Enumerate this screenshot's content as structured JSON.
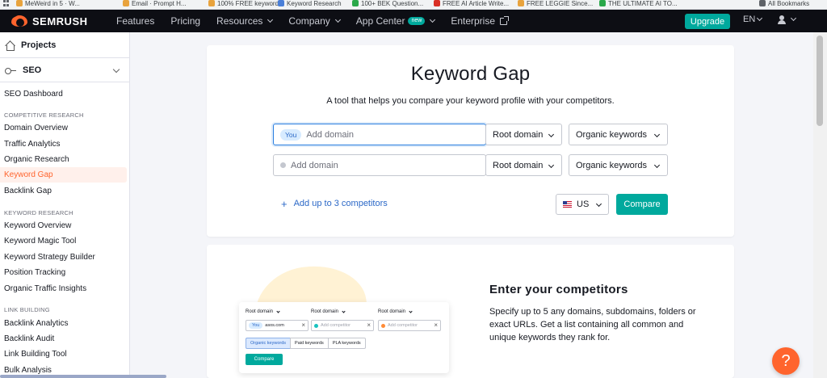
{
  "bookmarks": {
    "items": [
      {
        "label": "MeWeird in 5 · W...",
        "color": "#e8a33d"
      },
      {
        "label": "Email · Prompt H...",
        "color": "#e8a33d"
      },
      {
        "label": "100% FREE keyword...",
        "color": "#e8a33d"
      },
      {
        "label": "Keyword Research",
        "color": "#4a7fd8"
      },
      {
        "label": "100+ BEK Question...",
        "color": "#2aa84a"
      },
      {
        "label": "FREE AI Article Write...",
        "color": "#d93025"
      },
      {
        "label": "FREE LEGGIE Since...",
        "color": "#e8a33d"
      },
      {
        "label": "THE ULTIMATE AI TO...",
        "color": "#2aa84a"
      }
    ],
    "all_bookmarks": "All Bookmarks"
  },
  "nav": {
    "logo": "SEMRUSH",
    "items": [
      "Features",
      "Pricing",
      "Resources",
      "Company",
      "App Center",
      "Enterprise"
    ],
    "new_badge": "new",
    "upgrade": "Upgrade",
    "lang": "EN"
  },
  "sidebar": {
    "projects": "Projects",
    "seo": "SEO",
    "dashboard": "SEO Dashboard",
    "sections": {
      "competitive": "COMPETITIVE RESEARCH",
      "keyword": "KEYWORD RESEARCH",
      "link": "LINK BUILDING"
    },
    "competitive_items": [
      "Domain Overview",
      "Traffic Analytics",
      "Organic Research",
      "Keyword Gap",
      "Backlink Gap"
    ],
    "keyword_items": [
      "Keyword Overview",
      "Keyword Magic Tool",
      "Keyword Strategy Builder",
      "Position Tracking",
      "Organic Traffic Insights"
    ],
    "link_items": [
      "Backlink Analytics",
      "Backlink Audit",
      "Link Building Tool",
      "Bulk Analysis"
    ],
    "active_item": "Keyword Gap"
  },
  "main": {
    "title": "Keyword Gap",
    "subtitle": "A tool that helps you compare your keyword profile with your competitors.",
    "row1": {
      "chip": "You",
      "placeholder": "Add domain",
      "scope": "Root domain",
      "type": "Organic keywords"
    },
    "row2": {
      "placeholder": "Add domain",
      "scope": "Root domain",
      "type": "Organic keywords"
    },
    "add_competitors": "Add up to 3 competitors",
    "country": "US",
    "compare": "Compare"
  },
  "card2": {
    "title": "Enter your competitors",
    "text": "Specify up to 5 any domains, subdomains, folders or exact URLs. Get a list containing all common and unique keywords they rank for.",
    "illustration": {
      "labels": [
        "Root domain",
        "Root domain",
        "Root domain"
      ],
      "you": "You",
      "domain": "asos.com",
      "placeholder": "Add competitor",
      "tabs": [
        "Organic keywords",
        "Paid keywords",
        "PLA keywords"
      ],
      "compare": "Compare"
    }
  },
  "help": "?",
  "colors": {
    "accent": "#ff642d",
    "teal": "#00a99d",
    "link": "#2b68c7"
  }
}
